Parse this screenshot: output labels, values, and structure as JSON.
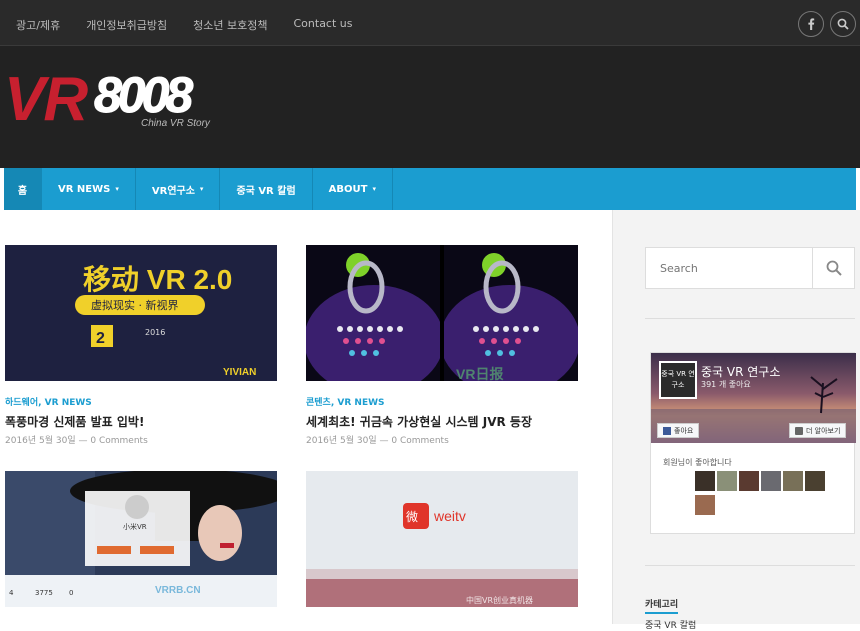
{
  "topbar": {
    "links": [
      "광고/제휴",
      "개인정보취급방침",
      "청소년 보호정책",
      "Contact us"
    ],
    "social_icon": "facebook-icon",
    "search_icon": "search-icon"
  },
  "logo": {
    "vr": "VR",
    "num": "8008",
    "sub": "China VR Story"
  },
  "nav": {
    "items": [
      {
        "label": "홈",
        "dropdown": false
      },
      {
        "label": "VR NEWS",
        "dropdown": true
      },
      {
        "label": "VR연구소",
        "dropdown": true
      },
      {
        "label": "중국 VR 칼럼",
        "dropdown": false
      },
      {
        "label": "ABOUT",
        "dropdown": true
      }
    ],
    "caret": "▾",
    "accent": "#1b9dd0"
  },
  "posts": [
    {
      "category": "하드웨어, VR NEWS",
      "title": "폭풍마경 신제품 발표 입박!",
      "date": "2016년 5월 30일",
      "comments": "0 Comments",
      "image": {
        "headline": "移动 VR 2.0",
        "sub": "虚拟现实 · 新视界",
        "year": "2016",
        "brand": "YIVIAN"
      }
    },
    {
      "category": "콘텐츠, VR NEWS",
      "title": "세계최초! 귀금속 가상현실 시스템 JVR 등장",
      "date": "2016년 5월 30일",
      "comments": "0 Comments",
      "image": {
        "watermark": "VR日报"
      }
    },
    {
      "category": "",
      "title": "",
      "date": "",
      "comments": "",
      "image": {
        "label": "小米VR",
        "stat1": "3775",
        "stat2": "0",
        "stat3": "4",
        "watermark": "VRRB.CN"
      }
    },
    {
      "category": "",
      "title": "",
      "date": "",
      "comments": "",
      "image": {
        "brand": "weitv",
        "watermark": "中国VR创业真机器"
      }
    }
  ],
  "sidebar": {
    "search_placeholder": "Search",
    "fb": {
      "thumb": "중국 VR 연구소",
      "name": "중국 VR 연구소",
      "likes": "391 개 좋아요",
      "like_btn": "좋아요",
      "more_btn": "더 알아보기",
      "friends": "회원님이 좋아합니다"
    },
    "category_title": "카테고리",
    "category_first": "중국 VR 칼럼"
  },
  "colors": {
    "topbar": "#2a2a2a",
    "header": "#222222",
    "logo_red": "#c7202f"
  }
}
